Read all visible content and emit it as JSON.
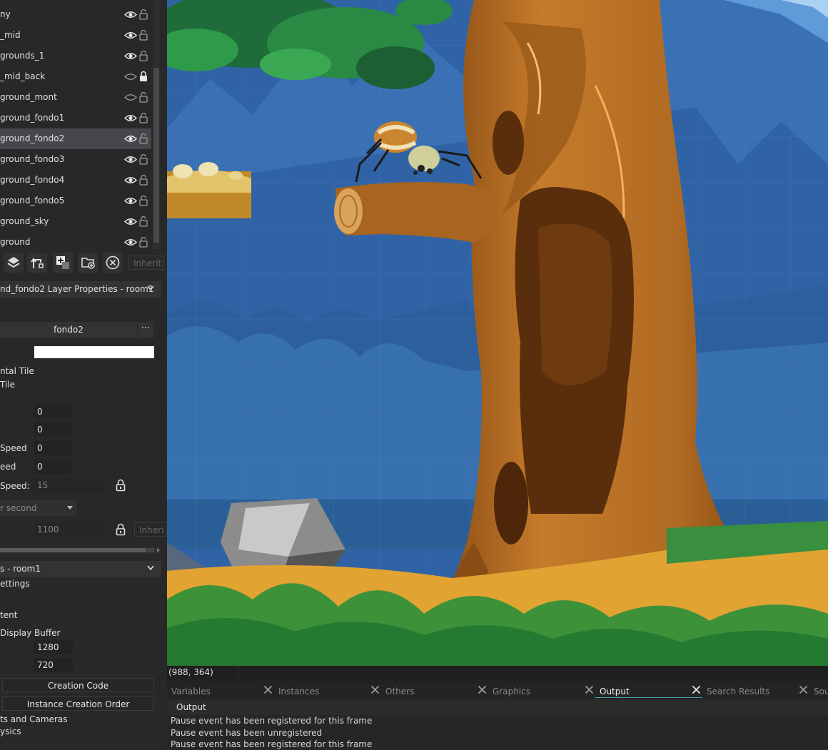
{
  "layers": {
    "items": [
      {
        "name": "ny",
        "visible": true,
        "locked": false
      },
      {
        "name": "_mid",
        "visible": true,
        "locked": false
      },
      {
        "name": "grounds_1",
        "visible": true,
        "locked": false
      },
      {
        "name": "_mid_back",
        "visible": false,
        "locked": true
      },
      {
        "name": "ground_mont",
        "visible": false,
        "locked": false
      },
      {
        "name": "ground_fondo1",
        "visible": true,
        "locked": false
      },
      {
        "name": "ground_fondo2",
        "visible": true,
        "locked": false,
        "selected": true
      },
      {
        "name": "ground_fondo3",
        "visible": true,
        "locked": false
      },
      {
        "name": "ground_fondo4",
        "visible": true,
        "locked": false
      },
      {
        "name": "ground_fondo5",
        "visible": true,
        "locked": false
      },
      {
        "name": "ground_sky",
        "visible": true,
        "locked": false
      },
      {
        "name": "ground",
        "visible": true,
        "locked": false
      }
    ],
    "inherit_label": "Inherit"
  },
  "layer_props": {
    "header": "nd_fondo2 Layer Properties - room1",
    "sprite_name": "fondo2",
    "sprite_menu": "···",
    "colour": "#ffffff",
    "htile_label": "ntal Tile",
    "vtile_label": " Tile",
    "x_value": "0",
    "y_value": "0",
    "hspeed_label": " Speed",
    "hspeed_value": "0",
    "vspeed_label": "eed",
    "vspeed_value": "0",
    "anim_speed_label": "Speed:",
    "anim_speed_value": "15",
    "speed_type": "r second",
    "depth_value": "1100",
    "inherit_label": "Inheri"
  },
  "room_props": {
    "header": "s - room1",
    "settings_label": "ettings",
    "persistent_label": "tent",
    "display_buffer_label": "Display Buffer",
    "width_value": "1280",
    "height_value": "720",
    "creation_code_button": "Creation Code",
    "instance_order_button": "Instance Creation Order",
    "viewports_label": "ts and Cameras",
    "physics_label": "ysics"
  },
  "status": {
    "coords": "(988, 364)"
  },
  "bottom_tabs": [
    {
      "label": "Variables",
      "active": false
    },
    {
      "label": "Instances",
      "active": false
    },
    {
      "label": "Others",
      "active": false
    },
    {
      "label": "Graphics",
      "active": false
    },
    {
      "label": "Output",
      "active": true
    },
    {
      "label": "Search Results",
      "active": false
    },
    {
      "label": "Sou",
      "active": false
    }
  ],
  "output": {
    "title": "Output",
    "lines": [
      "Pause event has been registered for this frame",
      "Pause event has been unregistered",
      "Pause event has been registered for this frame"
    ]
  },
  "colors": {
    "panel_bg": "#282828",
    "selected_row": "#45474d",
    "sky": "#2f62a3",
    "tab_accent": "#4aa0a0"
  }
}
